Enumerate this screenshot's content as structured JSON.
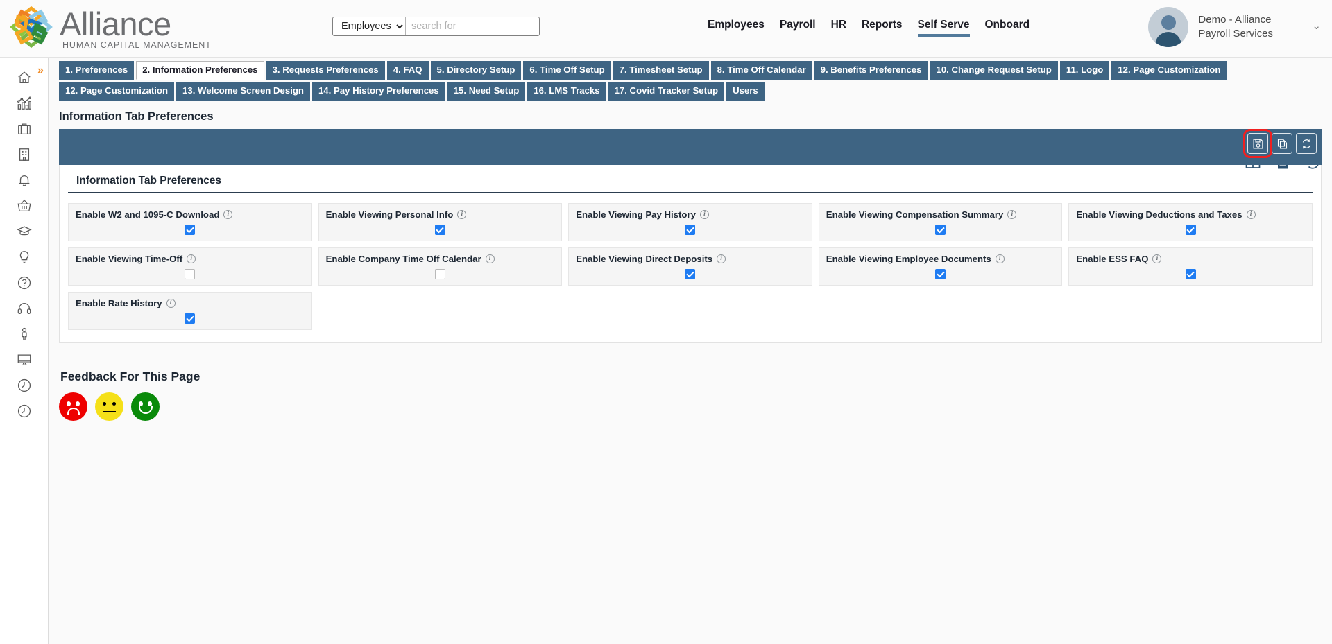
{
  "brand": {
    "name": "Alliance",
    "tagline": "HUMAN CAPITAL MANAGEMENT",
    "logo_icon": "alliance-star-logo",
    "colors": {
      "nav_blue": "#3e6483",
      "accent_underline": "#527a9b",
      "checkbox_blue": "#1f7cf2",
      "highlight_red": "#f02020",
      "expand_orange": "#f08a24"
    }
  },
  "search": {
    "scope_value": "Employees",
    "scope_options": [
      "Employees"
    ],
    "placeholder": "search for",
    "value": ""
  },
  "main_nav": [
    {
      "label": "Employees",
      "active": false
    },
    {
      "label": "Payroll",
      "active": false
    },
    {
      "label": "HR",
      "active": false
    },
    {
      "label": "Reports",
      "active": false
    },
    {
      "label": "Self Serve",
      "active": true
    },
    {
      "label": "Onboard",
      "active": false
    }
  ],
  "user": {
    "name": "Demo - Alliance Payroll Services",
    "avatar_icon": "user-avatar-icon",
    "chevron_icon": "chevron-down-icon"
  },
  "sidebar": {
    "expand_icon": "double-chevron-right-icon",
    "items": [
      {
        "icon": "home-icon",
        "name": "home"
      },
      {
        "icon": "analytics-chart-icon",
        "name": "analytics"
      },
      {
        "icon": "briefcase-icon",
        "name": "briefcase"
      },
      {
        "icon": "building-icon",
        "name": "company"
      },
      {
        "icon": "bell-icon",
        "name": "notifications"
      },
      {
        "icon": "basket-icon",
        "name": "basket"
      },
      {
        "icon": "graduation-cap-icon",
        "name": "learning"
      },
      {
        "icon": "lightbulb-icon",
        "name": "ideas"
      },
      {
        "icon": "question-circle-icon",
        "name": "help"
      },
      {
        "icon": "headset-icon",
        "name": "support"
      },
      {
        "icon": "person-icon",
        "name": "person"
      },
      {
        "icon": "monitor-icon",
        "name": "monitor"
      },
      {
        "icon": "clock-icon",
        "name": "clock-1"
      },
      {
        "icon": "clock-icon",
        "name": "clock-2"
      }
    ]
  },
  "tabs": [
    {
      "label": "1. Preferences",
      "active": false
    },
    {
      "label": "2. Information Preferences",
      "active": true
    },
    {
      "label": "3. Requests Preferences",
      "active": false
    },
    {
      "label": "4. FAQ",
      "active": false
    },
    {
      "label": "5. Directory Setup",
      "active": false
    },
    {
      "label": "6. Time Off Setup",
      "active": false
    },
    {
      "label": "7. Timesheet Setup",
      "active": false
    },
    {
      "label": "8. Time Off Calendar",
      "active": false
    },
    {
      "label": "9. Benefits Preferences",
      "active": false
    },
    {
      "label": "10. Change Request Setup",
      "active": false
    },
    {
      "label": "11. Logo",
      "active": false
    },
    {
      "label": "12. Page Customization",
      "active": false
    },
    {
      "label": "12. Page Customization",
      "active": false
    },
    {
      "label": "13. Welcome Screen Design",
      "active": false
    },
    {
      "label": "14. Pay History Preferences",
      "active": false
    },
    {
      "label": "15. Need Setup",
      "active": false
    },
    {
      "label": "16. LMS Tracks",
      "active": false
    },
    {
      "label": "17. Covid Tracker Setup",
      "active": false
    },
    {
      "label": "Users",
      "active": false
    }
  ],
  "page": {
    "title": "Information Tab Preferences",
    "panel_header": "Information Tab Preferences"
  },
  "header_tools": [
    {
      "icon": "grid-table-icon",
      "name": "grid-view"
    },
    {
      "icon": "document-icon",
      "name": "document-view"
    },
    {
      "icon": "history-clock-icon",
      "name": "history"
    }
  ],
  "toolbar": [
    {
      "icon": "save-floppy-icon",
      "name": "save",
      "highlighted": true
    },
    {
      "icon": "copy-pages-icon",
      "name": "copy",
      "highlighted": false
    },
    {
      "icon": "refresh-sync-icon",
      "name": "refresh",
      "highlighted": false
    }
  ],
  "preferences": [
    {
      "label": "Enable W2 and 1095-C Download",
      "checked": true
    },
    {
      "label": "Enable Viewing Personal Info",
      "checked": true
    },
    {
      "label": "Enable Viewing Pay History",
      "checked": true
    },
    {
      "label": "Enable Viewing Compensation Summary",
      "checked": true
    },
    {
      "label": "Enable Viewing Deductions and Taxes",
      "checked": true
    },
    {
      "label": "Enable Viewing Time-Off",
      "checked": false
    },
    {
      "label": "Enable Company Time Off Calendar",
      "checked": false
    },
    {
      "label": "Enable Viewing Direct Deposits",
      "checked": true
    },
    {
      "label": "Enable Viewing Employee Documents",
      "checked": true
    },
    {
      "label": "Enable ESS FAQ",
      "checked": true
    },
    {
      "label": "Enable Rate History",
      "checked": true
    }
  ],
  "feedback": {
    "title": "Feedback For This Page",
    "options": [
      {
        "name": "negative",
        "icon": "sad-face-icon",
        "color": "#ee0000"
      },
      {
        "name": "neutral",
        "icon": "neutral-face-icon",
        "color": "#f5e018"
      },
      {
        "name": "positive",
        "icon": "happy-face-icon",
        "color": "#0a8a0a"
      }
    ]
  }
}
